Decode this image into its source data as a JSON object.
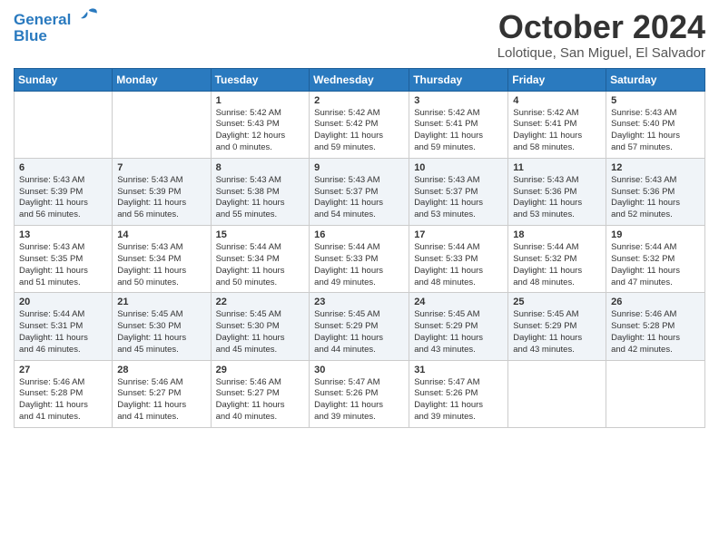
{
  "header": {
    "logo_line1": "General",
    "logo_line2": "Blue",
    "month": "October 2024",
    "location": "Lolotique, San Miguel, El Salvador"
  },
  "days_of_week": [
    "Sunday",
    "Monday",
    "Tuesday",
    "Wednesday",
    "Thursday",
    "Friday",
    "Saturday"
  ],
  "weeks": [
    [
      {
        "day": "",
        "content": ""
      },
      {
        "day": "",
        "content": ""
      },
      {
        "day": "1",
        "content": "Sunrise: 5:42 AM\nSunset: 5:43 PM\nDaylight: 12 hours\nand 0 minutes."
      },
      {
        "day": "2",
        "content": "Sunrise: 5:42 AM\nSunset: 5:42 PM\nDaylight: 11 hours\nand 59 minutes."
      },
      {
        "day": "3",
        "content": "Sunrise: 5:42 AM\nSunset: 5:41 PM\nDaylight: 11 hours\nand 59 minutes."
      },
      {
        "day": "4",
        "content": "Sunrise: 5:42 AM\nSunset: 5:41 PM\nDaylight: 11 hours\nand 58 minutes."
      },
      {
        "day": "5",
        "content": "Sunrise: 5:43 AM\nSunset: 5:40 PM\nDaylight: 11 hours\nand 57 minutes."
      }
    ],
    [
      {
        "day": "6",
        "content": "Sunrise: 5:43 AM\nSunset: 5:39 PM\nDaylight: 11 hours\nand 56 minutes."
      },
      {
        "day": "7",
        "content": "Sunrise: 5:43 AM\nSunset: 5:39 PM\nDaylight: 11 hours\nand 56 minutes."
      },
      {
        "day": "8",
        "content": "Sunrise: 5:43 AM\nSunset: 5:38 PM\nDaylight: 11 hours\nand 55 minutes."
      },
      {
        "day": "9",
        "content": "Sunrise: 5:43 AM\nSunset: 5:37 PM\nDaylight: 11 hours\nand 54 minutes."
      },
      {
        "day": "10",
        "content": "Sunrise: 5:43 AM\nSunset: 5:37 PM\nDaylight: 11 hours\nand 53 minutes."
      },
      {
        "day": "11",
        "content": "Sunrise: 5:43 AM\nSunset: 5:36 PM\nDaylight: 11 hours\nand 53 minutes."
      },
      {
        "day": "12",
        "content": "Sunrise: 5:43 AM\nSunset: 5:36 PM\nDaylight: 11 hours\nand 52 minutes."
      }
    ],
    [
      {
        "day": "13",
        "content": "Sunrise: 5:43 AM\nSunset: 5:35 PM\nDaylight: 11 hours\nand 51 minutes."
      },
      {
        "day": "14",
        "content": "Sunrise: 5:43 AM\nSunset: 5:34 PM\nDaylight: 11 hours\nand 50 minutes."
      },
      {
        "day": "15",
        "content": "Sunrise: 5:44 AM\nSunset: 5:34 PM\nDaylight: 11 hours\nand 50 minutes."
      },
      {
        "day": "16",
        "content": "Sunrise: 5:44 AM\nSunset: 5:33 PM\nDaylight: 11 hours\nand 49 minutes."
      },
      {
        "day": "17",
        "content": "Sunrise: 5:44 AM\nSunset: 5:33 PM\nDaylight: 11 hours\nand 48 minutes."
      },
      {
        "day": "18",
        "content": "Sunrise: 5:44 AM\nSunset: 5:32 PM\nDaylight: 11 hours\nand 48 minutes."
      },
      {
        "day": "19",
        "content": "Sunrise: 5:44 AM\nSunset: 5:32 PM\nDaylight: 11 hours\nand 47 minutes."
      }
    ],
    [
      {
        "day": "20",
        "content": "Sunrise: 5:44 AM\nSunset: 5:31 PM\nDaylight: 11 hours\nand 46 minutes."
      },
      {
        "day": "21",
        "content": "Sunrise: 5:45 AM\nSunset: 5:30 PM\nDaylight: 11 hours\nand 45 minutes."
      },
      {
        "day": "22",
        "content": "Sunrise: 5:45 AM\nSunset: 5:30 PM\nDaylight: 11 hours\nand 45 minutes."
      },
      {
        "day": "23",
        "content": "Sunrise: 5:45 AM\nSunset: 5:29 PM\nDaylight: 11 hours\nand 44 minutes."
      },
      {
        "day": "24",
        "content": "Sunrise: 5:45 AM\nSunset: 5:29 PM\nDaylight: 11 hours\nand 43 minutes."
      },
      {
        "day": "25",
        "content": "Sunrise: 5:45 AM\nSunset: 5:29 PM\nDaylight: 11 hours\nand 43 minutes."
      },
      {
        "day": "26",
        "content": "Sunrise: 5:46 AM\nSunset: 5:28 PM\nDaylight: 11 hours\nand 42 minutes."
      }
    ],
    [
      {
        "day": "27",
        "content": "Sunrise: 5:46 AM\nSunset: 5:28 PM\nDaylight: 11 hours\nand 41 minutes."
      },
      {
        "day": "28",
        "content": "Sunrise: 5:46 AM\nSunset: 5:27 PM\nDaylight: 11 hours\nand 41 minutes."
      },
      {
        "day": "29",
        "content": "Sunrise: 5:46 AM\nSunset: 5:27 PM\nDaylight: 11 hours\nand 40 minutes."
      },
      {
        "day": "30",
        "content": "Sunrise: 5:47 AM\nSunset: 5:26 PM\nDaylight: 11 hours\nand 39 minutes."
      },
      {
        "day": "31",
        "content": "Sunrise: 5:47 AM\nSunset: 5:26 PM\nDaylight: 11 hours\nand 39 minutes."
      },
      {
        "day": "",
        "content": ""
      },
      {
        "day": "",
        "content": ""
      }
    ]
  ]
}
